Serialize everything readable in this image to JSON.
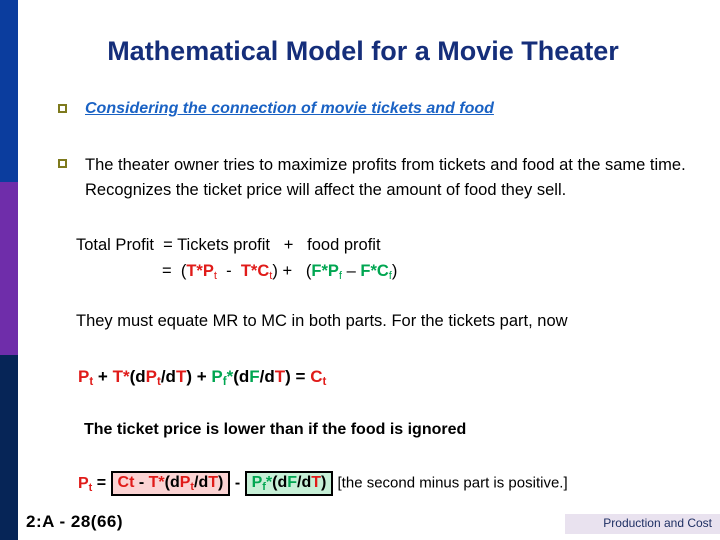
{
  "slide": {
    "title": "Mathematical Model for a Movie Theater",
    "bullets": [
      {
        "text": "Considering the connection of movie tickets and food"
      },
      {
        "text": "The theater owner tries to maximize profits from tickets and food at the same time.  Recognizes the ticket price will affect the amount of food they sell."
      }
    ],
    "equation_block": {
      "line1": {
        "label": "Total Profit",
        "equals": "=",
        "left_term": "Tickets profit",
        "plus": "+",
        "right_term": "food profit"
      },
      "line2": {
        "equals": "=",
        "open_paren": "(",
        "t_p_base": "T*P",
        "t_p_sub": "t",
        "minus": "-",
        "t_c_base": "T*C",
        "t_c_sub": "t",
        "close_paren": ")",
        "plus": "+",
        "open_paren2": "(",
        "f_p_base": "F*P",
        "f_p_sub": "f",
        "en_dash": "–",
        "f_c_base": "F*C",
        "f_c_sub": "f",
        "close_paren2": ")"
      }
    },
    "statement_mrmc": "They must equate MR to MC in both parts. For the tickets part, now",
    "formula_mr": {
      "p_base": "P",
      "p_sub": "t",
      "plus1": " + ",
      "t_star": "T*",
      "open1": "(d",
      "dp_base": "P",
      "dp_sub": "t",
      "slash_d": "/d",
      "t2": "T",
      "close1": ")",
      "plus2": " + ",
      "pf_base": "P",
      "pf_sub": "f",
      "star2": "*",
      "open2": "(d",
      "f_var": "F",
      "slash_d2": "/d",
      "t3": "T",
      "close2": ")",
      "equals": "  =  ",
      "c_base": "C",
      "c_sub": "t"
    },
    "statement_lower": "The ticket price is lower than if the food is ignored",
    "formula_pt": {
      "p_base": "P",
      "p_sub": "t",
      "equals": " = ",
      "box_red": {
        "ct": "Ct",
        "minus": "  -  ",
        "t_star": "T*",
        "open": "(d",
        "p_base": "P",
        "p_sub": "t",
        "slash_d": "/d",
        "t_var": "T",
        "close": ")"
      },
      "between_minus": " - ",
      "box_green": {
        "p_base": "P",
        "p_sub": "f",
        "star": "*",
        "open": "(d",
        "f_var": "F",
        "slash_d": "/d",
        "t_var": "T",
        "close": ")"
      },
      "note": " [the second minus part is positive.]"
    },
    "footer": {
      "left": "2:A - 28(66)",
      "right": "Production and Cost"
    },
    "colors": {
      "title": "#152e7a",
      "link_blue": "#1a62c4",
      "red": "#e01b19",
      "green": "#00a651",
      "bullet_marker": "#7e7a1d",
      "strip_blue": "#0b3d9e",
      "strip_purple": "#6f2daa",
      "strip_navy": "#062557",
      "box_red_fill": "#fbd3d3",
      "box_green_fill": "#c6efd6",
      "footer_band": "#e9e2ef"
    }
  }
}
